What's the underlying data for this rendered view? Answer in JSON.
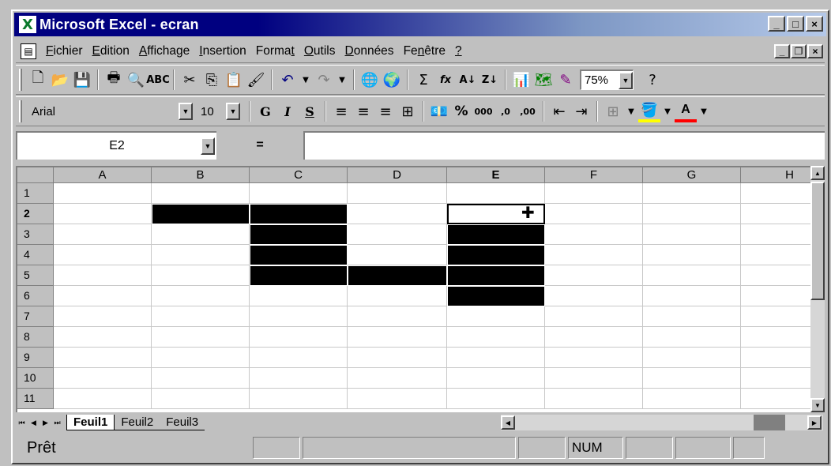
{
  "window": {
    "title": "Microsoft Excel - ecran",
    "app_icon_glyph": "X",
    "minimize_glyph": "_",
    "maximize_glyph": "□",
    "close_glyph": "×"
  },
  "menu": {
    "items": [
      {
        "pre": "",
        "u": "F",
        "post": "ichier"
      },
      {
        "pre": "",
        "u": "E",
        "post": "dition"
      },
      {
        "pre": "",
        "u": "A",
        "post": "ffichage"
      },
      {
        "pre": "",
        "u": "I",
        "post": "nsertion"
      },
      {
        "pre": "Forma",
        "u": "t",
        "post": ""
      },
      {
        "pre": "",
        "u": "O",
        "post": "utils"
      },
      {
        "pre": "",
        "u": "D",
        "post": "onnées"
      },
      {
        "pre": "Fe",
        "u": "n",
        "post": "être"
      },
      {
        "pre": "",
        "u": "?",
        "post": ""
      }
    ]
  },
  "standard_toolbar": {
    "zoom": "75%",
    "autosum_glyph": "Σ",
    "function_glyph": "fx"
  },
  "format_toolbar": {
    "font_name": "Arial",
    "font_size": "10",
    "bold_glyph": "G",
    "italic_glyph": "I",
    "underline_glyph": "S",
    "percent_glyph": "%",
    "thousands_glyph": "000",
    "inc_decimal_glyph": ",0",
    "dec_decimal_glyph": ",00"
  },
  "formula_bar": {
    "name_box": "E2",
    "equals_glyph": "=",
    "formula": ""
  },
  "sheet": {
    "columns": [
      "A",
      "B",
      "C",
      "D",
      "E",
      "F",
      "G",
      "H"
    ],
    "rows": [
      "1",
      "2",
      "3",
      "4",
      "5",
      "6",
      "7",
      "8",
      "9",
      "10",
      "11"
    ],
    "active_cell": "E2",
    "filled_cells": [
      "B2",
      "C2",
      "C3",
      "C4",
      "C5",
      "D5",
      "E3",
      "E4",
      "E5",
      "E6"
    ]
  },
  "tabs": {
    "sheets": [
      "Feuil1",
      "Feuil2",
      "Feuil3"
    ],
    "active": "Feuil1"
  },
  "status": {
    "ready": "Prêt",
    "num": "NUM"
  },
  "colors": {
    "title_start": "#000080",
    "title_end": "#b4c8e8",
    "chrome": "#c0c0c0",
    "excel_green": "#0a7a2c"
  }
}
